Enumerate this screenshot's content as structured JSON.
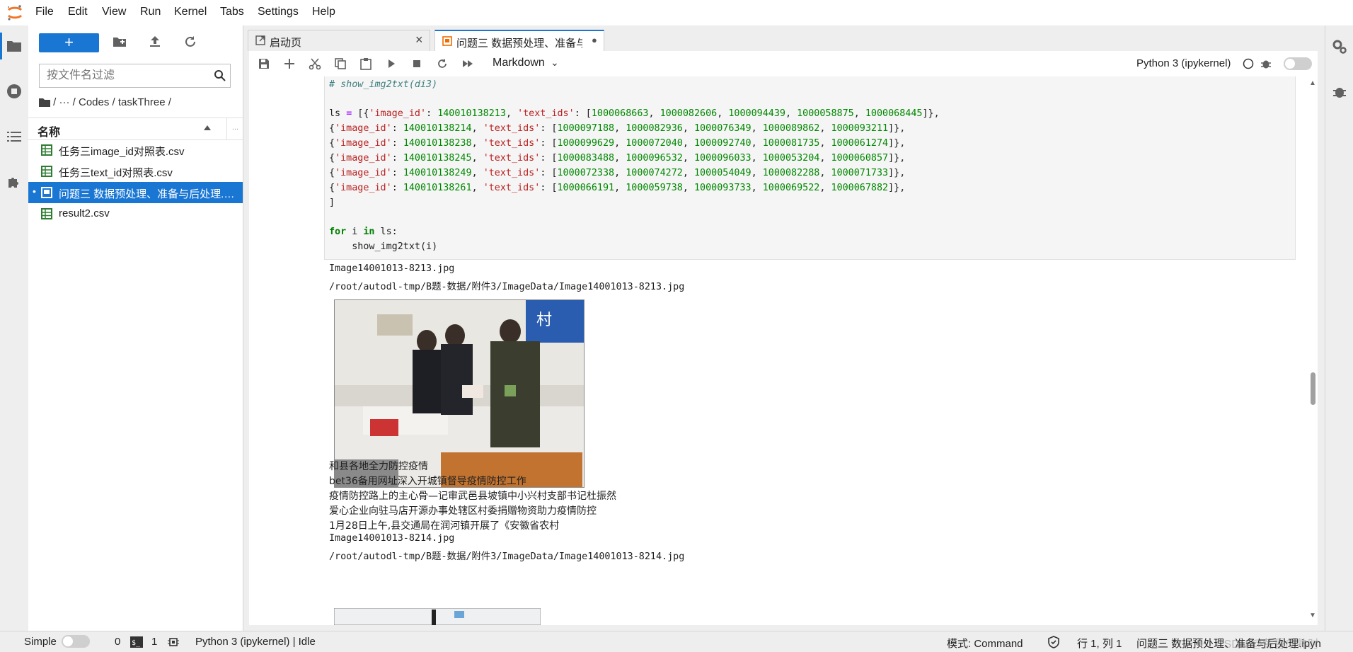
{
  "menu": {
    "items": [
      "File",
      "Edit",
      "View",
      "Run",
      "Kernel",
      "Tabs",
      "Settings",
      "Help"
    ]
  },
  "filebrowser": {
    "new_button": "+",
    "filter_placeholder": "按文件名过滤",
    "breadcrumb": "/  ···  / Codes / taskThree /",
    "column_name": "名称",
    "column_extra": "...",
    "files": [
      {
        "name": "任务三image_id对照表.csv",
        "type": "csv",
        "selected": false
      },
      {
        "name": "任务三text_id对照表.csv",
        "type": "csv",
        "selected": false
      },
      {
        "name": "问题三 数据预处理、准备与后处理.ipynb",
        "type": "notebook",
        "selected": true
      },
      {
        "name": "result2.csv",
        "type": "csv",
        "selected": false
      }
    ]
  },
  "tabs": [
    {
      "label": "启动页",
      "icon": "launcher-icon",
      "active": false,
      "close": "×"
    },
    {
      "label": "问题三 数据预处理、准备与后",
      "icon": "notebook-icon",
      "active": true,
      "close": "●"
    }
  ],
  "toolbar": {
    "cell_type": "Markdown",
    "kernel": "Python 3 (ipykernel)"
  },
  "code": {
    "comment": "# show_img2txt(di3)",
    "ls_rows": [
      {
        "image_id": "140010138213",
        "text_ids": [
          "1000068663",
          "1000082606",
          "1000094439",
          "1000058875",
          "1000068445"
        ]
      },
      {
        "image_id": "140010138214",
        "text_ids": [
          "1000097188",
          "1000082936",
          "1000076349",
          "1000089862",
          "1000093211"
        ]
      },
      {
        "image_id": "140010138238",
        "text_ids": [
          "1000099629",
          "1000072040",
          "1000092740",
          "1000081735",
          "1000061274"
        ]
      },
      {
        "image_id": "140010138245",
        "text_ids": [
          "1000083488",
          "1000096532",
          "1000096033",
          "1000053204",
          "1000060857"
        ]
      },
      {
        "image_id": "140010138249",
        "text_ids": [
          "1000072338",
          "1000074272",
          "1000054049",
          "1000082288",
          "1000071733"
        ]
      },
      {
        "image_id": "140010138261",
        "text_ids": [
          "1000066191",
          "1000059738",
          "1000093733",
          "1000069522",
          "1000067882"
        ]
      }
    ],
    "close_bracket": "]",
    "for_line": "for i in ls:",
    "call_line": "    show_img2txt(i)"
  },
  "output": {
    "file1": "Image14001013-8213.jpg",
    "path1": "/root/autodl-tmp/B题-数据/附件3/ImageData/Image14001013-8213.jpg",
    "texts": [
      "和县各地全力防控疫情",
      "bet36备用网址深入开城镇督导疫情防控工作",
      "疫情防控路上的主心骨—记审武邑县坡镇中小兴村支部书记杜振然",
      "爱心企业向驻马店开源办事处辖区村委捐赠物资助力疫情防控",
      "1月28日上午,县交通局在润河镇开展了《安徽省农村"
    ],
    "file2": "Image14001013-8214.jpg",
    "path2": "/root/autodl-tmp/B题-数据/附件3/ImageData/Image14001013-8214.jpg"
  },
  "status": {
    "mode_label": "Simple",
    "terminals": "0",
    "kernels": "1",
    "kernel_status": "Python 3 (ipykernel) | Idle",
    "command_mode": "模式: Command",
    "cursor": "行 1, 列 1",
    "filename": "问题三 数据预处理、准备与后处理.ipynb",
    "watermark": "CSDN @黄昏成熟时"
  },
  "colors": {
    "accent": "#1976d2",
    "csv_icon": "#2e7d32",
    "notebook_icon": "#ef6c00"
  }
}
